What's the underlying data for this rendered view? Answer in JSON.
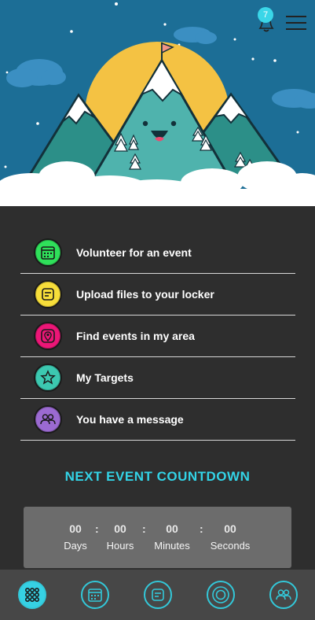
{
  "header": {
    "notification_count": "7",
    "icons": [
      "bell-icon",
      "hamburger-menu-icon"
    ]
  },
  "colors": {
    "sky": "#1c6e96",
    "sun": "#f4c243",
    "accent": "#33d3e6",
    "menu_green": "#2fe05a",
    "menu_yellow": "#f7de3a",
    "menu_pink": "#ec1677",
    "menu_teal": "#3cc8b0",
    "menu_purple": "#9b6ad1"
  },
  "menu": {
    "items": [
      {
        "label": "Volunteer for an event",
        "icon": "calendar-icon"
      },
      {
        "label": "Upload files to your locker",
        "icon": "locker-icon"
      },
      {
        "label": "Find events in my area",
        "icon": "map-pin-icon"
      },
      {
        "label": "My Targets",
        "icon": "star-icon"
      },
      {
        "label": "You have a message",
        "icon": "people-icon"
      }
    ]
  },
  "countdown": {
    "title": "NEXT EVENT COUNTDOWN",
    "separator": ":",
    "units": [
      {
        "value": "00",
        "label": "Days"
      },
      {
        "value": "00",
        "label": "Hours"
      },
      {
        "value": "00",
        "label": "Minutes"
      },
      {
        "value": "00",
        "label": "Seconds"
      }
    ]
  },
  "tabbar": {
    "tabs": [
      "grid-icon",
      "calendar-icon",
      "locker-icon",
      "target-icon",
      "people-icon"
    ],
    "active": "grid-icon"
  }
}
